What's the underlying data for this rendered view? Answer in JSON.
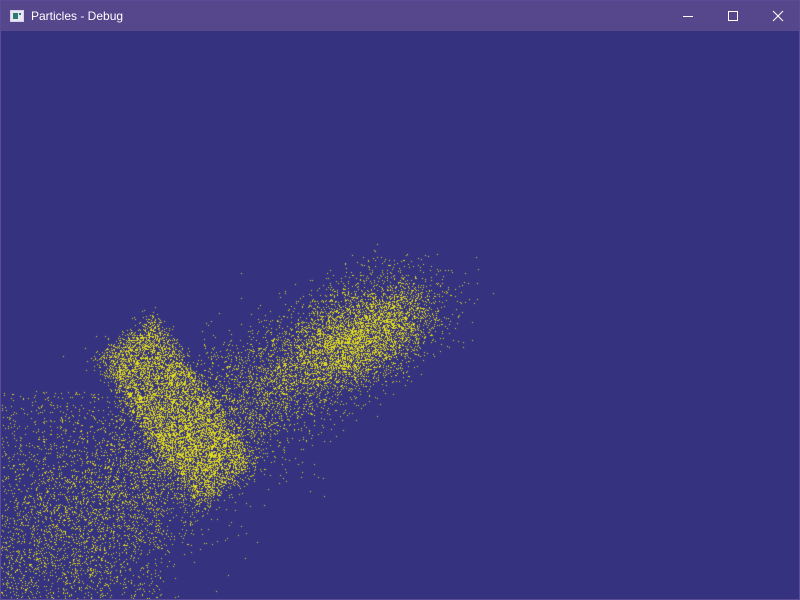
{
  "window": {
    "title": "Particles - Debug"
  },
  "controls": {
    "minimize_icon": "minimize-icon",
    "maximize_icon": "maximize-icon",
    "close_icon": "close-icon"
  },
  "colors": {
    "titlebar": "#56468c",
    "background": "#353380",
    "particle": "#e1db1d"
  }
}
